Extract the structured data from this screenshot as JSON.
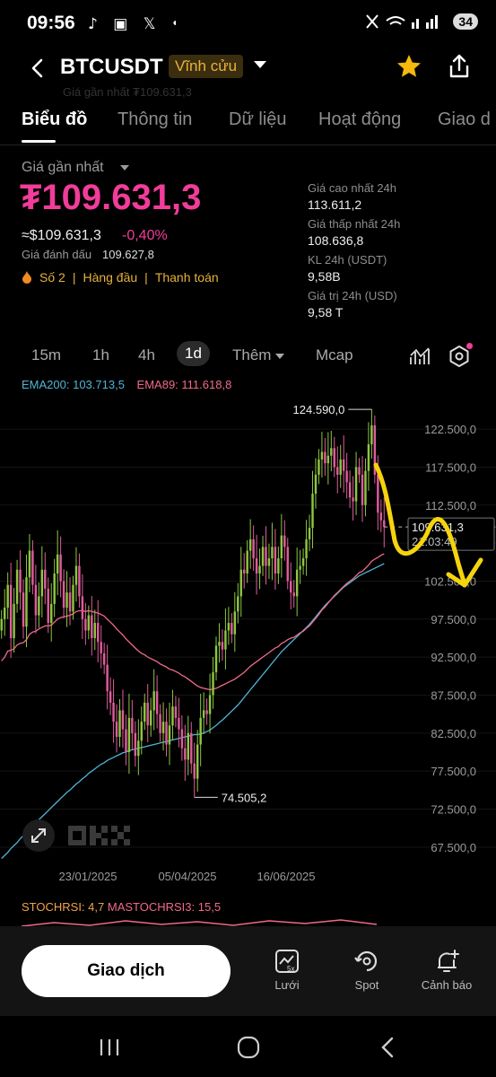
{
  "status_bar": {
    "time": "09:56",
    "battery": "34"
  },
  "header": {
    "symbol": "BTCUSDT",
    "contract_type": "Vĩnh cửu",
    "ghost_text": "Giá gần nhất  ₮109.631,3"
  },
  "tabs": [
    {
      "label": "Biểu đồ",
      "active": true
    },
    {
      "label": "Thông tin",
      "active": false
    },
    {
      "label": "Dữ liệu",
      "active": false
    },
    {
      "label": "Hoạt động",
      "active": false
    },
    {
      "label": "Giao d",
      "active": false
    }
  ],
  "price": {
    "last_label": "Giá gần nhất",
    "last_price": "₮109.631,3",
    "usd_price": "≈$109.631,3",
    "change": "-0,40%",
    "mark_label": "Giá đánh dấu",
    "mark_value": "109.627,8",
    "badges": [
      "Số 2",
      "Hàng đầu",
      "Thanh toán"
    ]
  },
  "stats": [
    {
      "label": "Giá cao nhất 24h",
      "value": "113.611,2"
    },
    {
      "label": "Giá thấp nhất 24h",
      "value": "108.636,8"
    },
    {
      "label": "KL 24h (USDT)",
      "value": "9,58B"
    },
    {
      "label": "Giá trị 24h (USD)",
      "value": "9,58 T"
    }
  ],
  "timeframes": {
    "items": [
      "15m",
      "1h",
      "4h",
      "1d"
    ],
    "active": "1d",
    "more": "Thêm",
    "mcap": "Mcap"
  },
  "chart_data": {
    "type": "candlestick",
    "legend": {
      "ema200": "EMA200: 103.713,5",
      "ema89": "EMA89: 111.618,8"
    },
    "y_ticks": [
      "122.500,0",
      "117.500,0",
      "112.500,0",
      "107.500,0",
      "102.500,0",
      "97.500,0",
      "92.500,0",
      "87.500,0",
      "82.500,0",
      "77.500,0",
      "72.500,0",
      "67.500,0"
    ],
    "x_ticks": [
      "23/01/2025",
      "05/04/2025",
      "16/06/2025"
    ],
    "high_annotation": "124.590,0",
    "low_annotation": "74.505,2",
    "current_price_label": "109.631,3",
    "countdown": "21:03:49",
    "ylim": [
      65000,
      127000
    ],
    "series": {
      "close": [
        97500,
        99000,
        102000,
        95000,
        99500,
        104000,
        101000,
        96500,
        103000,
        106500,
        102000,
        98000,
        100500,
        104000,
        101500,
        97000,
        99500,
        103500,
        106000,
        102500,
        99000,
        101000,
        98500,
        102000,
        104500,
        100500,
        97500,
        96000,
        98000,
        95000,
        97000,
        94500,
        93000,
        91500,
        88000,
        86500,
        84000,
        82000,
        85500,
        83000,
        80000,
        84500,
        82500,
        79500,
        81500,
        84000,
        86500,
        83500,
        85500,
        88000,
        85000,
        82500,
        84000,
        81000,
        83500,
        86000,
        84500,
        83000,
        80500,
        79000,
        82500,
        78500,
        76500,
        81000,
        84500,
        85500,
        85000,
        87500,
        90500,
        94000,
        94500,
        93500,
        96000,
        97000,
        95500,
        98500,
        100500,
        104000,
        103500,
        106500,
        108000,
        105500,
        103500,
        104500,
        107000,
        104500,
        105500,
        107000,
        103500,
        105500,
        108500,
        107000,
        102500,
        101000,
        100500,
        104000,
        104500,
        105500,
        108000,
        109500,
        114000,
        116500,
        118500,
        119500,
        118000,
        119000,
        120000,
        117500,
        116500,
        118500,
        117000,
        115500,
        113500,
        113000,
        117500,
        116500,
        112500,
        117000,
        120500,
        123000,
        116500,
        111500,
        110500,
        109631
      ],
      "ema89": [
        92000,
        92500,
        93300,
        93400,
        93600,
        94100,
        94300,
        94400,
        94800,
        95500,
        95800,
        95900,
        96200,
        96400,
        96600,
        96600,
        96700,
        97100,
        97500,
        97700,
        97800,
        97900,
        98000,
        98200,
        98500,
        98600,
        98600,
        98500,
        98600,
        98500,
        98400,
        98300,
        98100,
        97900,
        97500,
        97100,
        96700,
        96200,
        95800,
        95400,
        94900,
        94500,
        94100,
        93700,
        93300,
        93000,
        92800,
        92500,
        92300,
        92100,
        91900,
        91600,
        91400,
        91200,
        90900,
        90800,
        90600,
        90400,
        90100,
        89900,
        89600,
        89300,
        89000,
        88700,
        88500,
        88400,
        88300,
        88200,
        88300,
        88400,
        88600,
        88800,
        89000,
        89200,
        89400,
        89600,
        89900,
        90200,
        90500,
        90900,
        91300,
        91600,
        91900,
        92200,
        92500,
        92800,
        93100,
        93400,
        93700,
        93900,
        94300,
        94500,
        94800,
        95000,
        95100,
        95400,
        95700,
        95900,
        96300,
        96600,
        97100,
        97600,
        98100,
        98700,
        99100,
        99600,
        100100,
        100600,
        101000,
        101400,
        101800,
        102200,
        102500,
        102800,
        103200,
        103600,
        103800,
        104200,
        104600,
        105100,
        105400,
        105600,
        105900,
        106100
      ],
      "ema200": [
        66000,
        66400,
        66800,
        67300,
        67700,
        68100,
        68600,
        69000,
        69400,
        69900,
        70300,
        70700,
        71100,
        71500,
        71900,
        72300,
        72700,
        73100,
        73500,
        73900,
        74300,
        74700,
        75000,
        75400,
        75800,
        76100,
        76500,
        76800,
        77200,
        77500,
        77800,
        78100,
        78400,
        78600,
        78900,
        79100,
        79300,
        79500,
        79700,
        79900,
        80000,
        80200,
        80300,
        80400,
        80500,
        80600,
        80700,
        80800,
        80900,
        81000,
        81100,
        81200,
        81300,
        81400,
        81500,
        81600,
        81700,
        81800,
        81900,
        82000,
        82100,
        82200,
        82300,
        82300,
        82400,
        82500,
        82700,
        82900,
        83200,
        83500,
        83900,
        84200,
        84600,
        85000,
        85400,
        85800,
        86200,
        86700,
        87200,
        87700,
        88200,
        88700,
        89200,
        89700,
        90200,
        90700,
        91200,
        91700,
        92200,
        92700,
        93200,
        93600,
        94000,
        94400,
        94800,
        95200,
        95600,
        96000,
        96400,
        96800,
        97300,
        97800,
        98300,
        98800,
        99300,
        99700,
        100100,
        100500,
        100900,
        101300,
        101700,
        102000,
        102300,
        102600,
        102900,
        103200,
        103400,
        103600,
        103800,
        104000,
        104200,
        104400,
        104600,
        104800
      ]
    }
  },
  "stoch": {
    "label": "STOCHRSI: 4,7",
    "ma_label": "MASTOCHRSI3: 15,5"
  },
  "bottom_bar": {
    "trade": "Giao dịch",
    "items": [
      {
        "label": "Lưới",
        "icon": "grid-bot-icon"
      },
      {
        "label": "Spot",
        "icon": "spot-icon"
      },
      {
        "label": "Cảnh báo",
        "icon": "bell-plus-icon"
      }
    ]
  },
  "colors": {
    "up": "#8ec640",
    "down": "#e05c9c",
    "ema200": "#4fb5d6",
    "ema89": "#f06a8a",
    "accent_pink": "#f23c9a",
    "gold": "#e6b23c",
    "annotation_arrow": "#f5d40d"
  }
}
